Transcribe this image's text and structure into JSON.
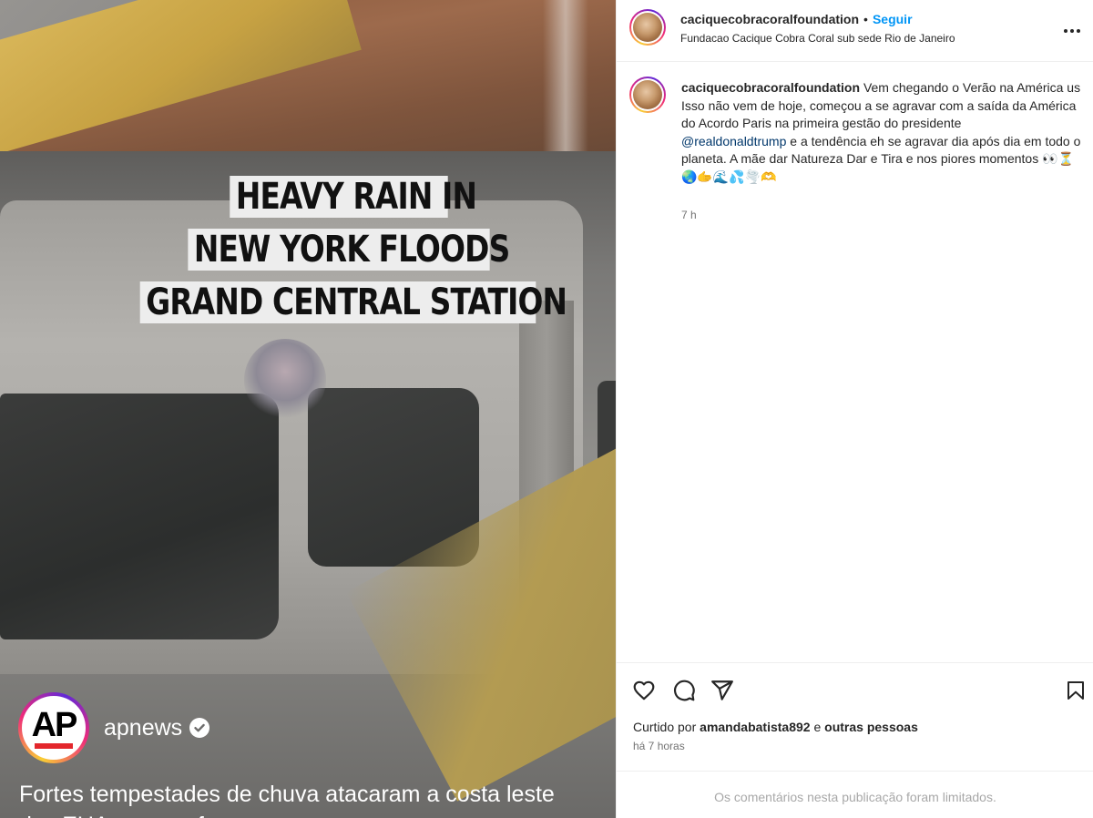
{
  "media": {
    "headline_lines": [
      "HEAVY RAIN IN",
      "NEW YORK FLOODS",
      "GRAND CENTRAL STATION"
    ],
    "source_account": "apnews",
    "source_logo_text": "AP",
    "caption_line1": "Fortes tempestades de chuva atacaram a costa leste",
    "caption_line2": "dos EUA, ... ... ... f ... ... ... ... ..."
  },
  "header": {
    "username": "caciquecobracoralfoundation",
    "separator": "•",
    "follow_label": "Seguir",
    "subtitle": "Fundacao Cacique Cobra Coral sub sede Rio de Janeiro"
  },
  "post": {
    "username": "caciquecobracoralfoundation",
    "text_intro": "Vem chegando o Verão na América us",
    "text_line2": "Isso não vem de hoje, começou a se agravar com a saída da América do Acordo Paris na primeira gestão do presidente",
    "mention": "@realdonaldtrump",
    "text_line3": "e a tendência eh se agravar dia após dia em todo o planeta. A mãe dar Natureza Dar e Tira e nos piores momentos",
    "emojis": "👀⏳🌏🫱🌊💦🌪️🫶",
    "time": "7 h"
  },
  "engagement": {
    "liked_by_prefix": "Curtido por",
    "liked_by_user": "amandabatista892",
    "liked_by_conj": "e",
    "liked_by_others": "outras pessoas",
    "time_ago": "há 7 horas",
    "comments_limited": "Os comentários nesta publicação foram limitados."
  },
  "colors": {
    "follow": "#0095f6",
    "mention": "#00376b",
    "text": "#262626",
    "muted": "#737373"
  },
  "icons": [
    "heart-icon",
    "comment-icon",
    "share-icon",
    "save-icon",
    "more-icon",
    "verified-icon"
  ]
}
